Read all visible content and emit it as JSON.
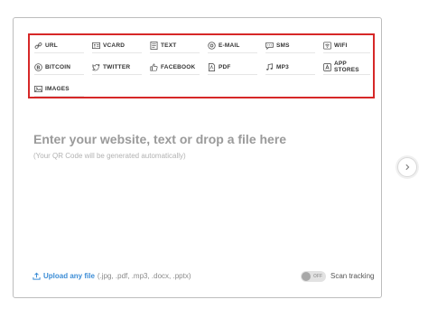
{
  "qr_types": [
    {
      "label": "URL",
      "icon": "link-icon"
    },
    {
      "label": "VCARD",
      "icon": "vcard-icon"
    },
    {
      "label": "TEXT",
      "icon": "text-icon"
    },
    {
      "label": "E-MAIL",
      "icon": "at-icon"
    },
    {
      "label": "SMS",
      "icon": "sms-icon"
    },
    {
      "label": "WIFI",
      "icon": "wifi-icon"
    },
    {
      "label": "BITCOIN",
      "icon": "bitcoin-icon"
    },
    {
      "label": "TWITTER",
      "icon": "twitter-icon"
    },
    {
      "label": "FACEBOOK",
      "icon": "thumbs-up-icon"
    },
    {
      "label": "PDF",
      "icon": "pdf-icon"
    },
    {
      "label": "MP3",
      "icon": "music-icon"
    },
    {
      "label": "APP STORES",
      "icon": "app-store-icon"
    },
    {
      "label": "IMAGES",
      "icon": "image-icon"
    }
  ],
  "input": {
    "headline": "Enter your website, text or drop a file here",
    "subline": "(Your QR Code will be generated automatically)"
  },
  "upload": {
    "link_label": "Upload any file",
    "file_types": "(.jpg, .pdf, .mp3, .docx, .pptx)",
    "icon": "upload-icon"
  },
  "scan_tracking": {
    "toggle_state": "OFF",
    "label": "Scan tracking"
  },
  "next_button": {
    "icon": "chevron-right-icon"
  },
  "colors": {
    "highlight_border": "#d62828",
    "link": "#3c8dd6",
    "headline": "#9a9a9a"
  }
}
